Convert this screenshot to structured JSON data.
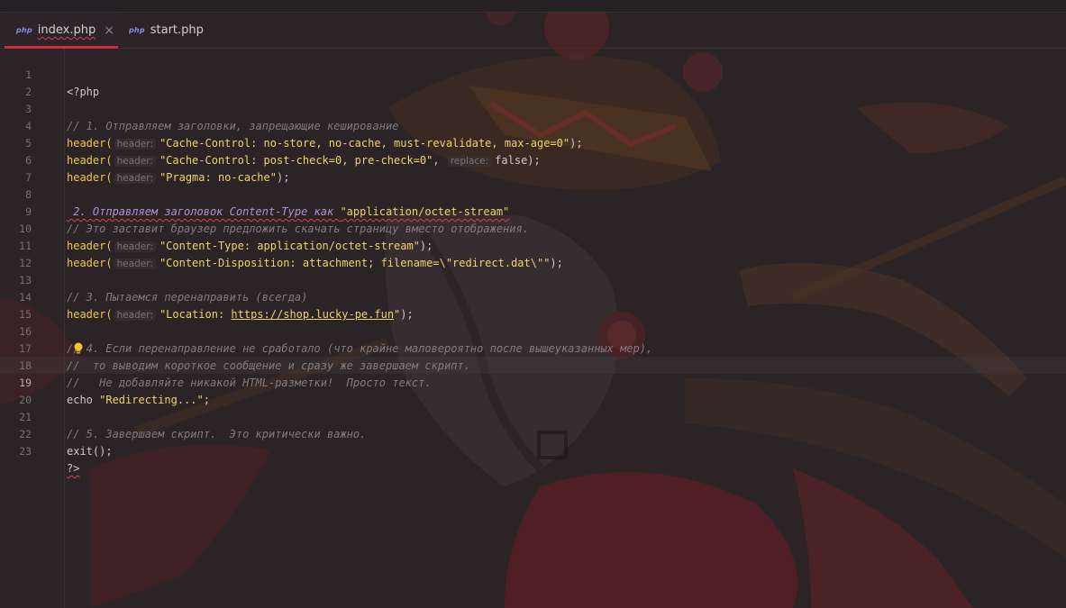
{
  "tabs": [
    {
      "badge": "php",
      "label": "index.php",
      "close": "×"
    },
    {
      "badge": "php",
      "label": "start.php"
    }
  ],
  "lines": [
    {
      "n": "1",
      "code": "<?php"
    },
    {
      "n": "2",
      "code": ""
    },
    {
      "n": "3",
      "comment": "// 1. Отправляем заголовки, запрещающие кеширование"
    },
    {
      "n": "4",
      "fn": "header(",
      "hint": "header:",
      "str": "\"Cache-Control: no-store, no-cache, must-revalidate, max-age=0\"",
      "tail": ");"
    },
    {
      "n": "5",
      "fn": "header(",
      "hint": "header:",
      "str": "\"Cache-Control: post-check=0, pre-check=0\"",
      "mid": ", ",
      "hint2": "replace:",
      "rest": "false);"
    },
    {
      "n": "6",
      "fn": "header(",
      "hint": "header:",
      "str": "\"Pragma: no-cache\"",
      "tail": ");"
    },
    {
      "n": "7",
      "code": ""
    },
    {
      "n": "8",
      "doc": " 2. Отправляем заголовок Content-Type как ",
      "doc_str": "\"application/octet-stream\""
    },
    {
      "n": "9",
      "comment": "// Это заставит браузер предложить скачать страницу вместо отображения."
    },
    {
      "n": "10",
      "fn": "header(",
      "hint": "header:",
      "str": "\"Content-Type: application/octet-stream\"",
      "tail": ");"
    },
    {
      "n": "11",
      "fn": "header(",
      "hint": "header:",
      "str": "\"Content-Disposition: attachment; filename=\\\"redirect.dat\\\"\"",
      "tail": ");"
    },
    {
      "n": "12",
      "code": ""
    },
    {
      "n": "13",
      "comment": "// 3. Пытаемся перенаправить (всегда)"
    },
    {
      "n": "14",
      "fn": "header(",
      "hint": "header:",
      "str_pre": "\"Location: ",
      "link": "https://shop.lucky-pe.fun",
      "str_post": "\"",
      "tail": ");"
    },
    {
      "n": "15",
      "code": ""
    },
    {
      "n": "16",
      "comment": "// 4. Если перенаправление не сработало (что крайне маловероятно после вышеуказанных мер),"
    },
    {
      "n": "17",
      "comment": "//  то выводим короткое сообщение и сразу же завершаем скрипт."
    },
    {
      "n": "18",
      "comment": "//   Не добавляйте никакой HTML-разметки!  Просто текст."
    },
    {
      "n": "19",
      "kw": "echo ",
      "str": "\"Redirecting...\"",
      "tail": ";"
    },
    {
      "n": "20",
      "code": ""
    },
    {
      "n": "21",
      "comment": "// 5. Завершаем скрипт.  Это критически важно."
    },
    {
      "n": "22",
      "code": "exit();"
    },
    {
      "n": "23",
      "code": "?>"
    }
  ],
  "colors": {
    "accent": "#c8313c",
    "function": "#f1c64a",
    "string": "#f0d36a",
    "comment": "#857a7e",
    "doc_comment": "#b48fd9"
  }
}
